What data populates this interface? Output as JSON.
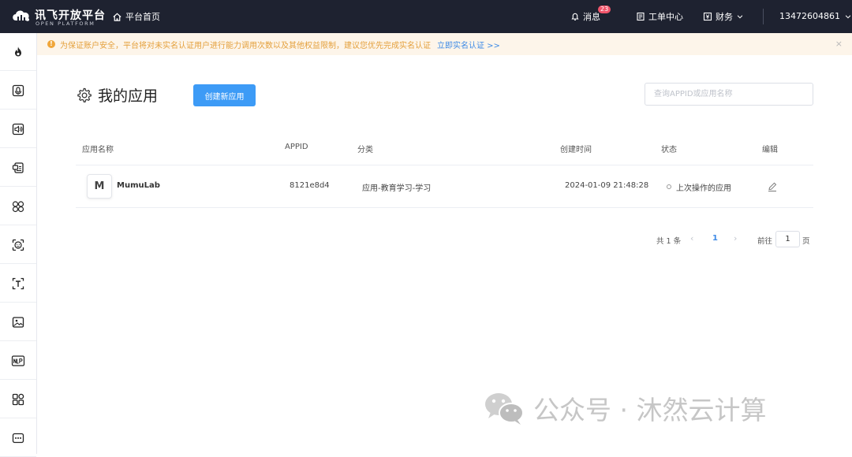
{
  "header": {
    "brand_title": "讯飞开放平台",
    "brand_subtitle": "OPEN PLATFORM",
    "home_label": "平台首页",
    "messages_label": "消息",
    "messages_count": "23",
    "tickets_label": "工单中心",
    "finance_label": "财务",
    "username": "13472604861"
  },
  "sidebar": {
    "items": [
      {
        "icon": "flame-icon"
      },
      {
        "icon": "speech-recognition-icon"
      },
      {
        "icon": "speech-synthesis-icon"
      },
      {
        "icon": "document-translate-icon"
      },
      {
        "icon": "face-compare-icon"
      },
      {
        "icon": "face-scan-icon"
      },
      {
        "icon": "text-recognition-icon"
      },
      {
        "icon": "image-icon"
      },
      {
        "icon": "nlp-icon"
      },
      {
        "icon": "apps-grid-icon"
      },
      {
        "icon": "more-icon"
      }
    ]
  },
  "notice": {
    "icon": "!",
    "text": "为保证账户安全，平台将对未实名认证用户进行能力调用次数以及其他权益限制，建议您优先完成实名认证",
    "link": "立即实名认证 >>",
    "close": "×"
  },
  "main": {
    "title": "我的应用",
    "create_button": "创建新应用",
    "search_placeholder": "查询APPID或应用名称",
    "columns": [
      "应用名称",
      "APPID",
      "分类",
      "创建时间",
      "状态",
      "编辑"
    ],
    "rows": [
      {
        "avatar": "M",
        "name": "MumuLab",
        "appid": "8121e8d4",
        "category": "应用-教育学习-学习",
        "created": "2024-01-09 21:48:28",
        "status": "上次操作的应用"
      }
    ]
  },
  "pagination": {
    "total": "共 1 条",
    "prev": "‹",
    "current": "1",
    "next": "›",
    "goto_label": "前往",
    "goto_value": "1",
    "page_suffix": "页"
  },
  "watermark": {
    "text": "公众号 · 沐然云计算"
  },
  "colors": {
    "topbar_bg": "#1e2230",
    "accent": "#3d9bf6",
    "notice_bg": "#fdf5ea",
    "notice_text": "#e4a03c",
    "badge": "#f0556b"
  }
}
